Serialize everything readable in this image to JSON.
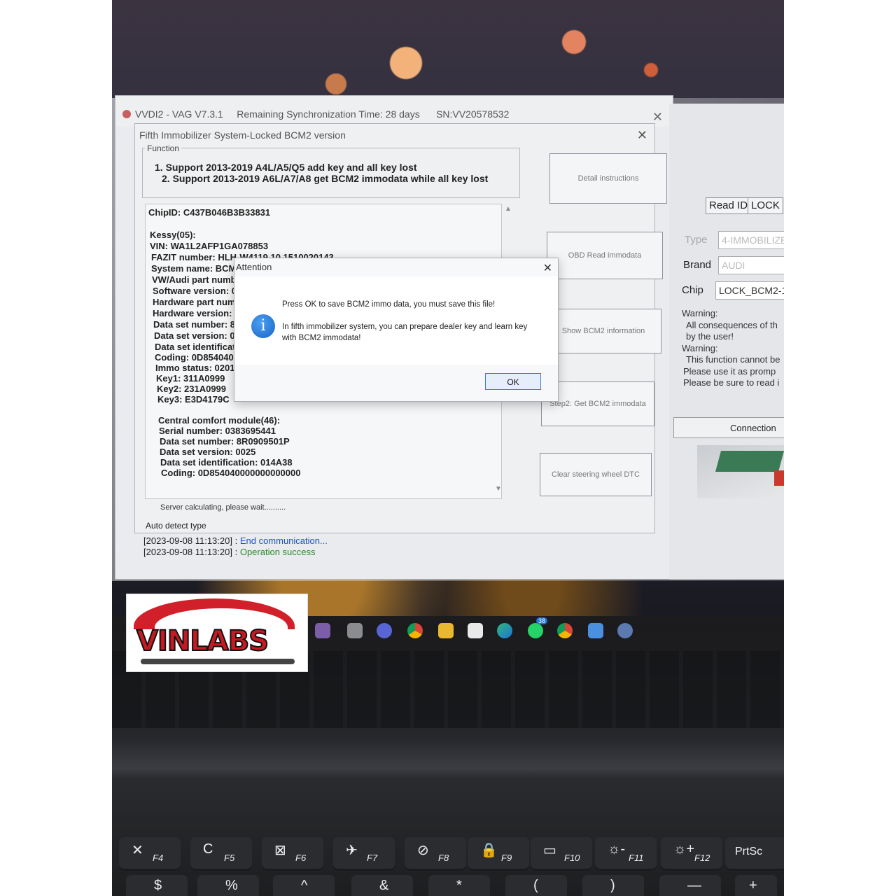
{
  "main_window": {
    "title": "VVDI2 - VAG V7.3.1",
    "sync": "Remaining Synchronization Time: 28 days",
    "serial": "SN:VV20578532",
    "log": [
      {
        "ts": "[2023-09-08 11:13:20]",
        "sep": " : ",
        "msg": "End communication...",
        "color": "#1f4fd1"
      },
      {
        "ts": "[2023-09-08 11:13:20]",
        "sep": " : ",
        "msg": "Operation success",
        "color": "#2b8a2b"
      }
    ]
  },
  "right_panel": {
    "read_id": "Read ID",
    "lock": "LOCK",
    "type_label": "Type",
    "type_value": "4-IMMOBILIZE",
    "brand_label": "Brand",
    "brand_value": "AUDI",
    "chip_label": "Chip",
    "chip_value": "LOCK_BCM2-1",
    "warnings": [
      "Warning:",
      "All consequences of th",
      "by the user!",
      "Warning:",
      "This function cannot be",
      "Please use it as promp",
      "Please be sure to read i"
    ],
    "connection": "Connection"
  },
  "bcm_dialog": {
    "title": "Fifth Immobilizer System-Locked BCM2 version",
    "function_label": "Function",
    "function_lines": [
      "1. Support 2013-2019 A4L/A5/Q5 add key and all key lost",
      "2. Support 2013-2019 A6L/A7/A8 get BCM2 immodata while all key lost"
    ],
    "buttons": {
      "detail": "Detail instructions",
      "obd": "OBD Read immodata",
      "show_bcm2": "Show BCM2 information",
      "step2": "Step2: Get BCM2 immodata",
      "clear_dtc": "Clear steering wheel DTC"
    },
    "info_lines": [
      "ChipID: C437B046B3B33831",
      "",
      "Kessy(05):",
      "VIN: WA1L2AFP1GA078853",
      "FAZIT number: HLH-W4119 10 1510020143",
      "System name: BCM",
      "VW/Audi part numb",
      "Software version: 0",
      "Hardware part num",
      "Hardware version:",
      "Data set number: 8",
      "Data set version: 0",
      "Data set identificati",
      "Coding: 0D8540400",
      "Immo status: 02010",
      "Key1: 311A0999",
      "Key2: 231A0999",
      "Key3: E3D4179C",
      "",
      "Central comfort module(46):",
      "Serial number: 0383695441",
      "Data set number: 8R0909501P",
      "Data set version: 0025",
      "Data set identification: 014A38",
      "Coding: 0D854040000000000000"
    ],
    "status": "Server calculating, please wait..........",
    "auto_detect": "Auto detect type"
  },
  "modal": {
    "title": "Attention",
    "line1": "Press OK to save BCM2 immo data, you must save this file!",
    "line2": "In fifth immobilizer system, you can prepare dealer key and learn key",
    "line3": "with BCM2 immodata!",
    "ok": "OK"
  },
  "taskbar": {
    "badge": "38"
  },
  "keyboard": {
    "fkeys": [
      {
        "sym": "✕",
        "fn": "F4"
      },
      {
        "sym": "C",
        "fn": "F5"
      },
      {
        "sym": "⊠",
        "fn": "F6"
      },
      {
        "sym": "✈",
        "fn": "F7"
      },
      {
        "sym": "⊘",
        "fn": "F8"
      },
      {
        "sym": "🔒",
        "fn": "F9"
      },
      {
        "sym": "▭",
        "fn": "F10"
      },
      {
        "sym": "☼-",
        "fn": "F11"
      },
      {
        "sym": "☼+",
        "fn": "F12"
      }
    ],
    "prtsc": "PrtSc",
    "number_row": [
      "$",
      "%",
      "^",
      "&",
      "*",
      "(",
      ")",
      "—",
      "+"
    ]
  },
  "watermark": {
    "text": "VINLABS"
  },
  "colors": {
    "accent_blue": "#1a64c8",
    "log_blue": "#1f4fd1",
    "log_green": "#2b8a2b",
    "logo_red": "#d1202a"
  }
}
